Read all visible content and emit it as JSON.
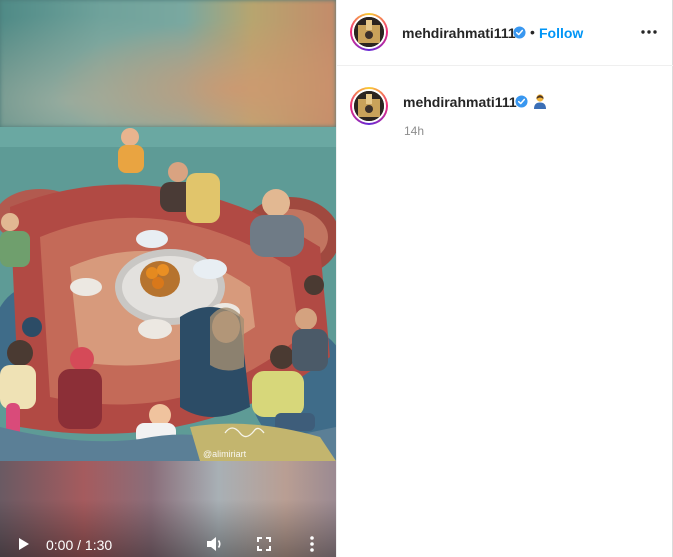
{
  "post": {
    "username": "mehdirahmati111",
    "follow_label": "Follow",
    "separator": "•",
    "time_ago": "14h"
  },
  "caption": {
    "username": "mehdirahmati111",
    "emoji": "person-emoji"
  },
  "video": {
    "time_display": "0:00 / 1:30",
    "watermark": "@alimiriart"
  },
  "colors": {
    "accent": "#0095f6",
    "verified": "#3897f0",
    "text": "#262626",
    "muted": "#8e8e8e"
  }
}
